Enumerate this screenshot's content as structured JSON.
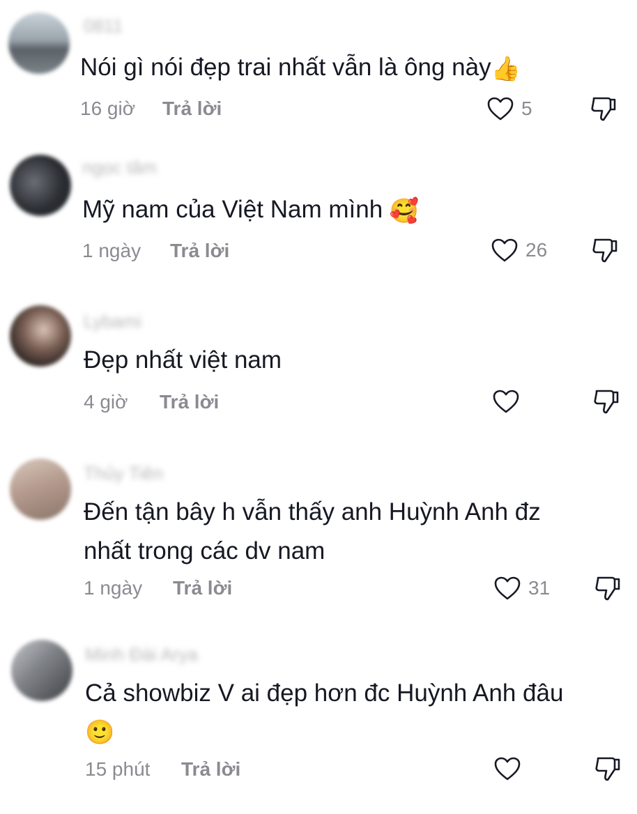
{
  "comments": [
    {
      "username": "0811",
      "text": "Nói gì nói đẹp trai nhất vẫn là ông này",
      "emoji": "👍",
      "time": "16 giờ",
      "reply": "Trả lời",
      "likes": "5",
      "avatar_color": "#7f8a93"
    },
    {
      "username": "ngọc tâm",
      "text": "Mỹ nam của Việt Nam mình",
      "emoji": "🥰",
      "time": "1 ngày",
      "reply": "Trả lời",
      "likes": "26",
      "avatar_color": "#3a3d44"
    },
    {
      "username": "Lybami",
      "text": "Đẹp nhất việt nam",
      "emoji": "",
      "time": "4 giờ",
      "reply": "Trả lời",
      "likes": "",
      "avatar_color": "#4a3a34"
    },
    {
      "username": "Thủy Tiên",
      "text_line1": "Đến tận bây h vẫn thấy anh Huỳnh Anh đz",
      "text_line2": "nhất trong các dv nam",
      "time": "1 ngày",
      "reply": "Trả lời",
      "likes": "31",
      "avatar_color": "#b49c90"
    },
    {
      "username": "Minh Đài Arya",
      "text": "Cả showbiz V ai đẹp hơn đc Huỳnh Anh đâu",
      "emoji": "🙂",
      "time": "15 phút",
      "reply": "Trả lời",
      "likes": "",
      "avatar_color": "#55575c"
    }
  ],
  "colors": {
    "text": "#161823",
    "muted": "#8a8b91",
    "username_blur": "#b8b8bc"
  },
  "icons": {
    "like": "heart-outline-icon",
    "dislike": "thumbs-down-outline-icon"
  }
}
